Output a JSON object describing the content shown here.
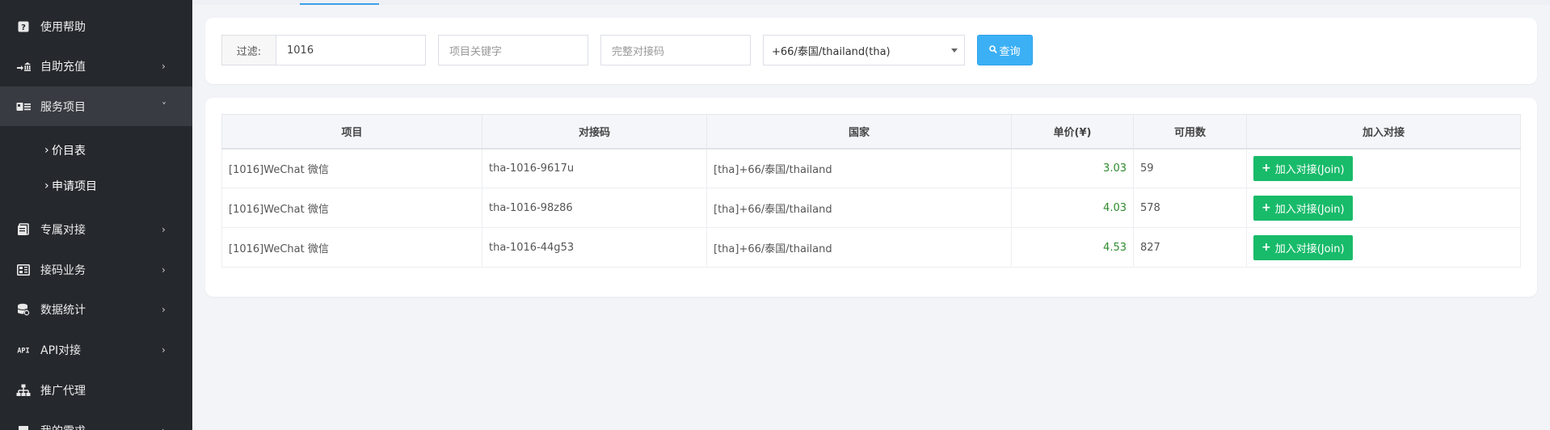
{
  "sidebar": {
    "items": [
      {
        "label": "使用帮助",
        "icon": "help-icon",
        "arrow": ""
      },
      {
        "label": "自助充值",
        "icon": "recharge-icon",
        "arrow": "›"
      },
      {
        "label": "服务项目",
        "icon": "service-icon",
        "arrow": "˅",
        "active": true
      },
      {
        "label": "专属对接",
        "icon": "document-icon",
        "arrow": "›"
      },
      {
        "label": "接码业务",
        "icon": "grid-icon",
        "arrow": "›"
      },
      {
        "label": "数据统计",
        "icon": "database-icon",
        "arrow": "›"
      },
      {
        "label": "API对接",
        "icon": "api-icon",
        "arrow": "›"
      },
      {
        "label": "推广代理",
        "icon": "sitemap-icon",
        "arrow": ""
      },
      {
        "label": "我的需求",
        "icon": "flag-icon",
        "arrow": "›"
      }
    ],
    "subitems": [
      {
        "mark": "›",
        "label": "价目表"
      },
      {
        "mark": "›",
        "label": "申请项目"
      }
    ]
  },
  "filter": {
    "addon_label": "过滤:",
    "filter_value": "1016",
    "keyword_placeholder": "项目关键字",
    "code_placeholder": "完整对接码",
    "country_selected": "+66/泰国/thailand(tha)",
    "query_label": "查询",
    "query_icon": "search-icon"
  },
  "table": {
    "headers": [
      "项目",
      "对接码",
      "国家",
      "单价(¥)",
      "可用数",
      "加入对接"
    ],
    "rows": [
      {
        "project": "[1016]WeChat 微信",
        "code": "tha-1016-9617u",
        "country": "[tha]+66/泰国/thailand",
        "price": "3.03",
        "available": "59",
        "join_label": "加入对接(Join)"
      },
      {
        "project": "[1016]WeChat 微信",
        "code": "tha-1016-98z86",
        "country": "[tha]+66/泰国/thailand",
        "price": "4.03",
        "available": "578",
        "join_label": "加入对接(Join)"
      },
      {
        "project": "[1016]WeChat 微信",
        "code": "tha-1016-44g53",
        "country": "[tha]+66/泰国/thailand",
        "price": "4.53",
        "available": "827",
        "join_label": "加入对接(Join)"
      }
    ]
  },
  "colors": {
    "sidebar_bg": "#25282d",
    "accent_blue": "#3cb0f5",
    "join_green": "#18bb6a",
    "price_green": "#2e8b2e"
  }
}
